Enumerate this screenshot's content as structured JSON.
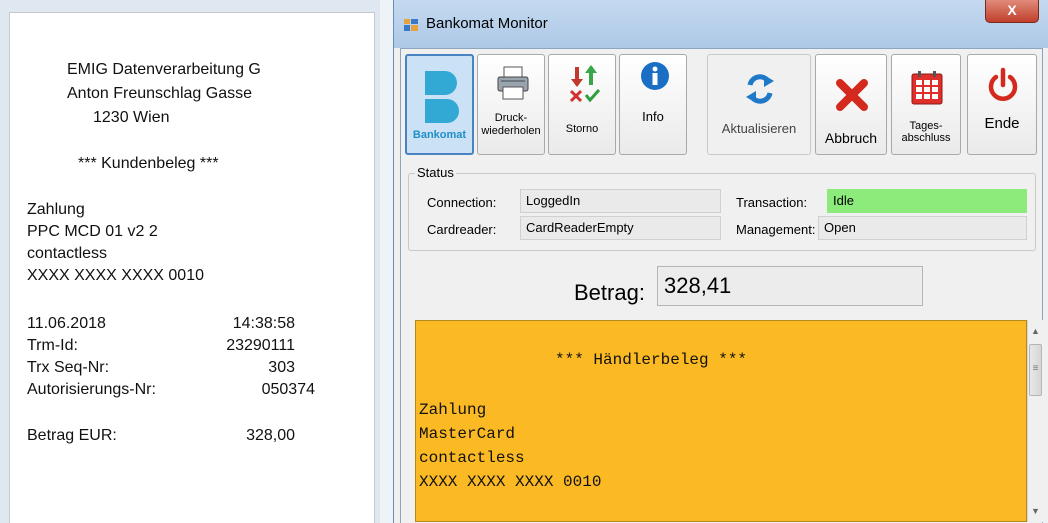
{
  "receipt": {
    "company": "EMIG Datenverarbeitung G",
    "street": "Anton Freunschlag Gasse",
    "city": "1230 Wien",
    "title": "*** Kundenbeleg ***",
    "type": "Zahlung",
    "product": "PPC MCD 01 v2 2",
    "mode": "contactless",
    "card": "XXXX XXXX XXXX 0010",
    "date": "11.06.2018",
    "time": "14:38:58",
    "trm_label": "Trm-Id:",
    "trm_value": "23290111",
    "trx_label": "Trx Seq-Nr:",
    "trx_value": "303",
    "auth_label": "Autorisierungs-Nr:",
    "auth_value": "050374",
    "amount_label": "Betrag EUR:",
    "amount_value": "328,00"
  },
  "window": {
    "title": "Bankomat Monitor",
    "close": "X"
  },
  "toolbar": {
    "bankomat": "Bankomat",
    "druck1": "Druck-",
    "druck2": "wiederholen",
    "storno": "Storno",
    "info": "Info",
    "aktualisieren": "Aktualisieren",
    "abbruch": "Abbruch",
    "tages1": "Tages-",
    "tages2": "abschluss",
    "ende": "Ende"
  },
  "status": {
    "group_label": "Status",
    "connection_label": "Connection:",
    "connection_value": "LoggedIn",
    "cardreader_label": "Cardreader:",
    "cardreader_value": "CardReaderEmpty",
    "transaction_label": "Transaction:",
    "transaction_value": "Idle",
    "management_label": "Management:",
    "management_value": "Open"
  },
  "amount": {
    "label": "Betrag:",
    "value": "328,41"
  },
  "journal": {
    "title": "*** Händlerbeleg ***",
    "line1": "Zahlung",
    "line2": "MasterCard",
    "line3": "contactless",
    "line4": "XXXX XXXX XXXX 0010"
  },
  "colors": {
    "journal_bg": "#fbba24",
    "idle_green": "#8ceb7a",
    "bankomat_brand": "#32a9d4"
  }
}
